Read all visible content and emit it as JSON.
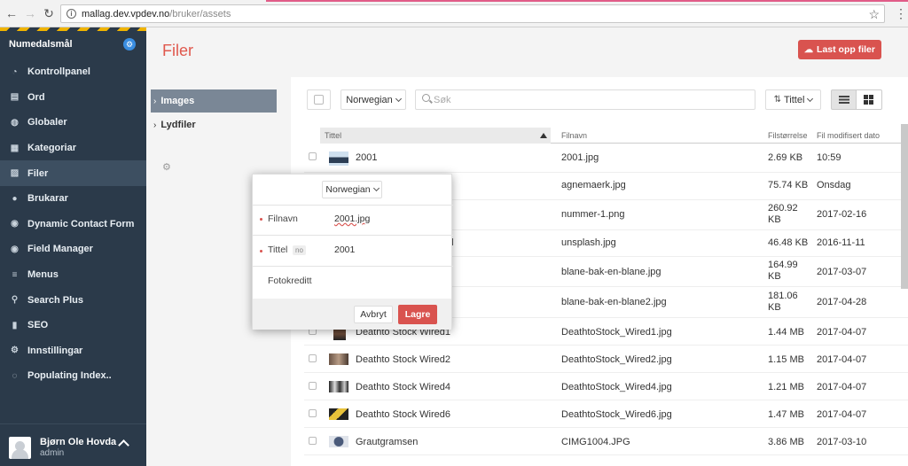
{
  "browser": {
    "url_host": "mallag.dev.vpdev.no",
    "url_path": "/bruker/assets"
  },
  "sidebar": {
    "brand": "Numedalsmål",
    "items": [
      {
        "label": "Kontrollpanel",
        "icon": "dashboard-icon"
      },
      {
        "label": "Ord",
        "icon": "document-icon"
      },
      {
        "label": "Globaler",
        "icon": "globe-icon"
      },
      {
        "label": "Kategoriar",
        "icon": "category-icon"
      },
      {
        "label": "Filer",
        "icon": "image-icon",
        "active": true
      },
      {
        "label": "Brukarar",
        "icon": "users-icon"
      },
      {
        "label": "Dynamic Contact Form",
        "icon": "form-icon"
      },
      {
        "label": "Field Manager",
        "icon": "fields-icon"
      },
      {
        "label": "Menus",
        "icon": "menu-icon"
      },
      {
        "label": "Search Plus",
        "icon": "search-icon"
      },
      {
        "label": "SEO",
        "icon": "chart-icon"
      },
      {
        "label": "Innstillingar",
        "icon": "gear-icon"
      },
      {
        "label": "Populating Index..",
        "icon": "spinner-icon"
      }
    ],
    "user": {
      "name": "Bjørn Ole Hovda",
      "role": "admin"
    }
  },
  "main": {
    "title": "Filer",
    "upload_label": "Last opp filer",
    "folders": [
      {
        "label": "Images",
        "active": true
      },
      {
        "label": "Lydfiler",
        "active": false
      }
    ],
    "toolbar": {
      "language": "Norwegian",
      "search_placeholder": "Søk",
      "sort_label": "Tittel"
    },
    "table": {
      "columns": [
        "Tittel",
        "Filnavn",
        "Filstørrelse",
        "Fil modifisert dato"
      ],
      "rows": [
        {
          "title": "2001",
          "filename": "2001.jpg",
          "size": "2.69 KB",
          "modified": "10:59"
        },
        {
          "title": "",
          "filename": "agnemaerk.jpg",
          "size": "75.74 KB",
          "modified": "Onsdag"
        },
        {
          "title": "",
          "filename": "nummer-1.png",
          "size": "260.92 KB",
          "modified": "2017-02-16"
        },
        {
          "title": "el",
          "filename": "unsplash.jpg",
          "size": "46.48 KB",
          "modified": "2016-11-11"
        },
        {
          "title": "",
          "filename": "blane-bak-en-blane.jpg",
          "size": "164.99 KB",
          "modified": "2017-03-07"
        },
        {
          "title": "",
          "filename": "blane-bak-en-blane2.jpg",
          "size": "181.06 KB",
          "modified": "2017-04-28"
        },
        {
          "title": "Deathto Stock Wired1",
          "filename": "DeathtoStock_Wired1.jpg",
          "size": "1.44 MB",
          "modified": "2017-04-07"
        },
        {
          "title": "Deathto Stock Wired2",
          "filename": "DeathtoStock_Wired2.jpg",
          "size": "1.15 MB",
          "modified": "2017-04-07"
        },
        {
          "title": "Deathto Stock Wired4",
          "filename": "DeathtoStock_Wired4.jpg",
          "size": "1.21 MB",
          "modified": "2017-04-07"
        },
        {
          "title": "Deathto Stock Wired6",
          "filename": "DeathtoStock_Wired6.jpg",
          "size": "1.47 MB",
          "modified": "2017-04-07"
        },
        {
          "title": "Grautgramsen",
          "filename": "CIMG1004.JPG",
          "size": "3.86 MB",
          "modified": "2017-03-10"
        }
      ]
    }
  },
  "modal": {
    "language": "Norwegian",
    "filename_label": "Filnavn",
    "filename_value": "2001.jpg",
    "title_label": "Tittel",
    "title_badge": "no",
    "title_value": "2001",
    "credit_label": "Fotokreditt",
    "cancel_label": "Avbryt",
    "save_label": "Lagre"
  }
}
